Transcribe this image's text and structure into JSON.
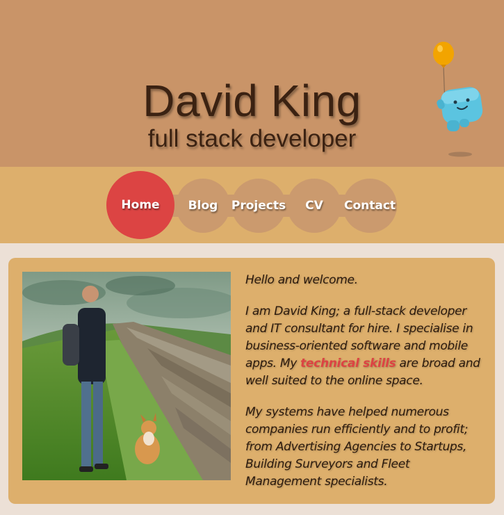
{
  "header": {
    "title": "David King",
    "subtitle": "full stack developer",
    "mascot_icon": "balloon-robot-icon"
  },
  "nav": {
    "items": [
      {
        "label": "Home",
        "active": true
      },
      {
        "label": "Blog",
        "active": false
      },
      {
        "label": "Projects",
        "active": false
      },
      {
        "label": "CV",
        "active": false
      },
      {
        "label": "Contact",
        "active": false
      }
    ]
  },
  "intro": {
    "greeting": "Hello and welcome.",
    "p1_before": "I am David King; a full-stack developer and IT consultant for hire. I specialise in business-oriented software and mobile apps. My ",
    "p1_link": "technical skills",
    "p1_after": " are broad and well suited to the online space.",
    "p2": "My systems have helped numerous companies run efficiently and to profit; from Advertising Agencies to Startups, Building Surveyors and Fleet Management specialists."
  },
  "colors": {
    "header_bg": "#c99468",
    "nav_bg": "#ddaf6c",
    "nav_bubble": "#cb9a6e",
    "nav_active": "#dc4443",
    "page_bg": "#ece0d6",
    "link": "#dc4443"
  }
}
